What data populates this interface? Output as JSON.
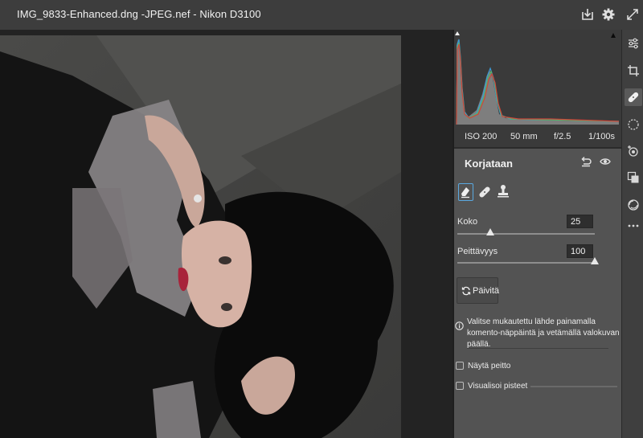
{
  "window": {
    "title": "IMG_9833-Enhanced.dng -JPEG.nef -  Nikon D3100"
  },
  "exif": {
    "iso": "ISO 200",
    "focal_length": "50 mm",
    "aperture": "f/2.5",
    "shutter": "1/100s"
  },
  "section": {
    "title": "Korjataan"
  },
  "sliders": {
    "size_label": "Koko",
    "size_value": "25",
    "size_fraction": 0.24,
    "opacity_label": "Peittävyys",
    "opacity_value": "100",
    "opacity_fraction": 1.0
  },
  "update_button": {
    "label": "Päivitä"
  },
  "info": {
    "text": "Valitse mukautettu lähde painamalla komento-näppäintä ja vetämällä valokuvan päällä."
  },
  "options": {
    "show_overlay": "Näytä peitto",
    "show_overlay_checked": false,
    "visualize_spots": "Visualisoi pisteet",
    "visualize_spots_checked": false
  },
  "icons": {
    "titlebar": [
      "save-icon",
      "gear-icon",
      "fullscreen-icon"
    ],
    "tools": [
      "edit-sliders-icon",
      "crop-icon",
      "heal-icon",
      "mask-icon",
      "red-eye-icon",
      "presets-icon",
      "snapshots-icon",
      "more-icon"
    ],
    "heal_modes": [
      "content-aware-remove-icon",
      "heal-icon",
      "clone-icon"
    ]
  },
  "colors": {
    "accent": "#5aa8e0",
    "panel": "#535353",
    "titlebar": "#3d3d3d"
  }
}
